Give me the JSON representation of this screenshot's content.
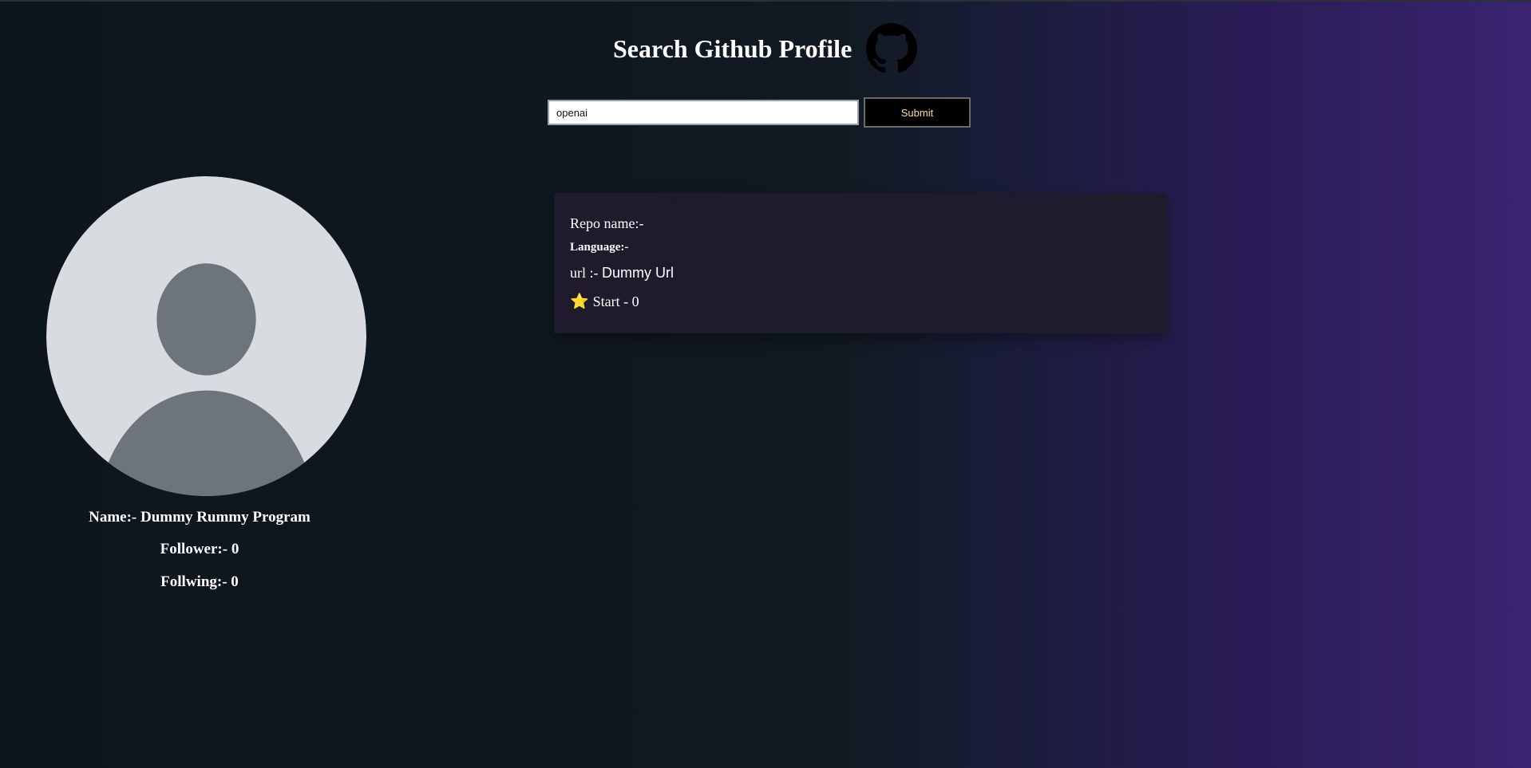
{
  "header": {
    "title": "Search Github Profile",
    "logo_icon": "github-octocat-icon"
  },
  "search": {
    "value": "openai",
    "submit_label": "Submit"
  },
  "profile": {
    "avatar_icon": "default-user-avatar-icon",
    "name": "Name:- Dummy Rummy Program",
    "followers": "Follower:- 0",
    "following": "Follwing:- 0"
  },
  "repo": {
    "name_label": "Repo name:-",
    "language_label": "Language:-",
    "url_prefix": "url :- ",
    "url_value": "Dummy Url",
    "star_icon": "star-icon",
    "stars": "Start - 0"
  },
  "colors": {
    "background_start": "#0d161d",
    "background_end": "#3a2470",
    "card": "#1f1a2c",
    "submit_text": "#ffd9a8"
  }
}
